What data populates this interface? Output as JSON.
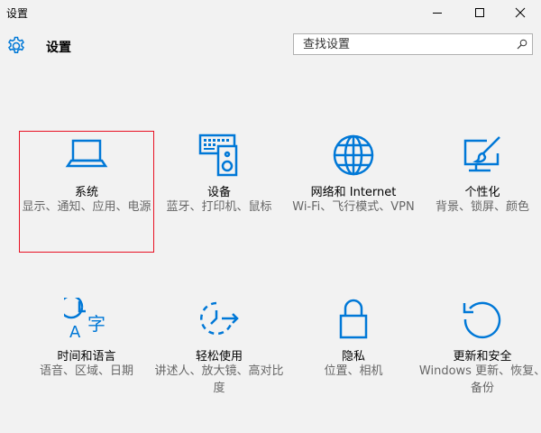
{
  "window": {
    "title": "设置",
    "controls": [
      "minimize",
      "maximize",
      "close"
    ]
  },
  "header": {
    "icon": "gear-icon",
    "title": "设置",
    "accent": "#0078d7"
  },
  "search": {
    "placeholder": "查找设置",
    "icon": "search-icon"
  },
  "tiles": [
    {
      "icon": "laptop-icon",
      "label": "系统",
      "desc": "显示、通知、应用、电源",
      "selected": true
    },
    {
      "icon": "keyboard-speaker-icon",
      "label": "设备",
      "desc": "蓝牙、打印机、鼠标"
    },
    {
      "icon": "globe-icon",
      "label": "网络和 Internet",
      "desc": "Wi-Fi、飞行模式、VPN"
    },
    {
      "icon": "personalize-icon",
      "label": "个性化",
      "desc": "背景、锁屏、颜色"
    },
    {
      "icon": "time-language-icon",
      "label": "时间和语言",
      "desc": "语音、区域、日期"
    },
    {
      "icon": "ease-of-access-icon",
      "label": "轻松使用",
      "desc": "讲述人、放大镜、高对比度"
    },
    {
      "icon": "lock-icon",
      "label": "隐私",
      "desc": "位置、相机"
    },
    {
      "icon": "update-icon",
      "label": "更新和安全",
      "desc": "Windows 更新、恢复、备份"
    }
  ],
  "colors": {
    "background": "#f2f2f2",
    "icon": "#0078d7",
    "selection_border": "#e81123",
    "desc_text": "#666666"
  }
}
